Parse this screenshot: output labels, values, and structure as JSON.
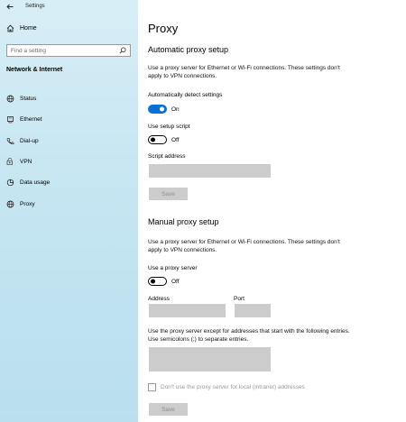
{
  "window": {
    "title": "Settings"
  },
  "sidebar": {
    "home_label": "Home",
    "search_placeholder": "Find a setting",
    "section": "Network & Internet",
    "items": [
      {
        "label": "Status",
        "icon": "globe-icon"
      },
      {
        "label": "Ethernet",
        "icon": "ethernet-icon"
      },
      {
        "label": "Dial-up",
        "icon": "phone-icon"
      },
      {
        "label": "VPN",
        "icon": "vpn-icon"
      },
      {
        "label": "Data usage",
        "icon": "data-usage-icon"
      },
      {
        "label": "Proxy",
        "icon": "globe-icon"
      }
    ]
  },
  "main": {
    "title": "Proxy",
    "automatic": {
      "heading": "Automatic proxy setup",
      "description": "Use a proxy server for Ethernet or Wi-Fi connections. These settings don't apply to VPN connections.",
      "detect_label": "Automatically detect settings",
      "detect_state": "On",
      "script_label": "Use setup script",
      "script_state": "Off",
      "address_label": "Script address",
      "address_value": "",
      "save_label": "Save"
    },
    "manual": {
      "heading": "Manual proxy setup",
      "description": "Use a proxy server for Ethernet or Wi-Fi connections. These settings don't apply to VPN connections.",
      "proxy_label": "Use a proxy server",
      "proxy_state": "Off",
      "address_label": "Address",
      "address_value": "",
      "port_label": "Port",
      "port_value": "",
      "exceptions_description": "Use the proxy server except for addresses that start with the following entries. Use semicolons (;) to separate entries.",
      "exceptions_value": "",
      "local_checkbox_label": "Don't use the proxy server for local (intranet) addresses",
      "save_label": "Save"
    }
  },
  "colors": {
    "accent": "#0a70d6",
    "sidebar_bg": "#c7e6f2",
    "disabled_bg": "#cccccc"
  }
}
